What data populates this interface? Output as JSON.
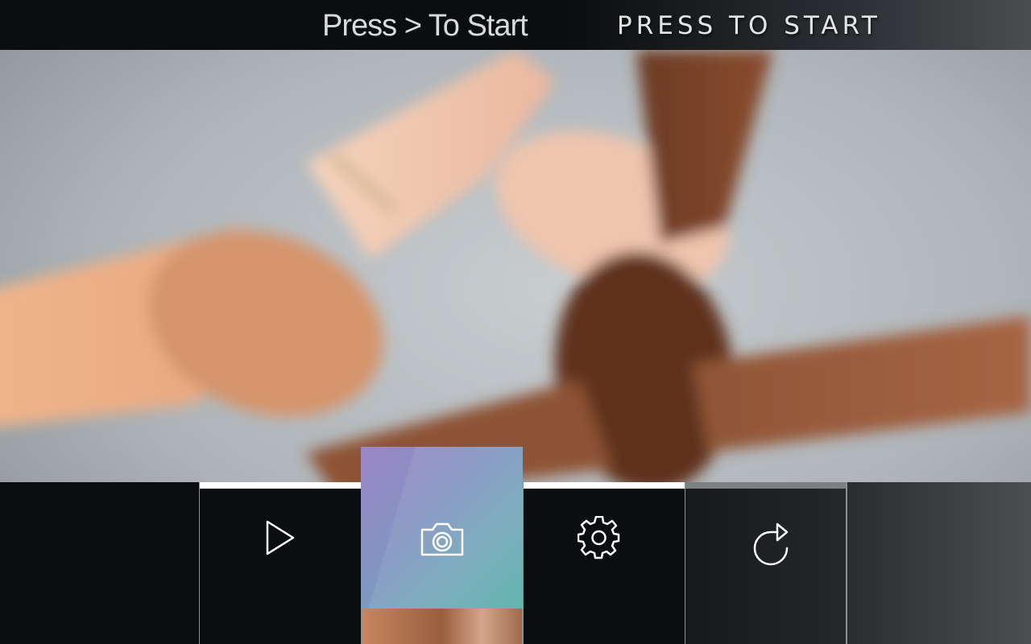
{
  "header": {
    "title_left": "Press > To Start",
    "title_right": "PRESS TO START"
  },
  "photo": {
    "subject": "hands-linked-photo"
  },
  "toolbar": {
    "tiles": [
      {
        "name": "play",
        "icon": "play-icon",
        "indicator": "white"
      },
      {
        "name": "camera",
        "icon": "camera-icon",
        "selected": true
      },
      {
        "name": "settings",
        "icon": "gear-icon",
        "indicator": "white"
      },
      {
        "name": "reload",
        "icon": "reload-icon",
        "indicator": "grey"
      }
    ]
  },
  "colors": {
    "background": "#0b0e10",
    "accent_gradient_start": "#9b84c6",
    "accent_gradient_end": "#55b0a8",
    "indicator_active": "#ffffff",
    "indicator_inactive": "#7d7f81"
  }
}
